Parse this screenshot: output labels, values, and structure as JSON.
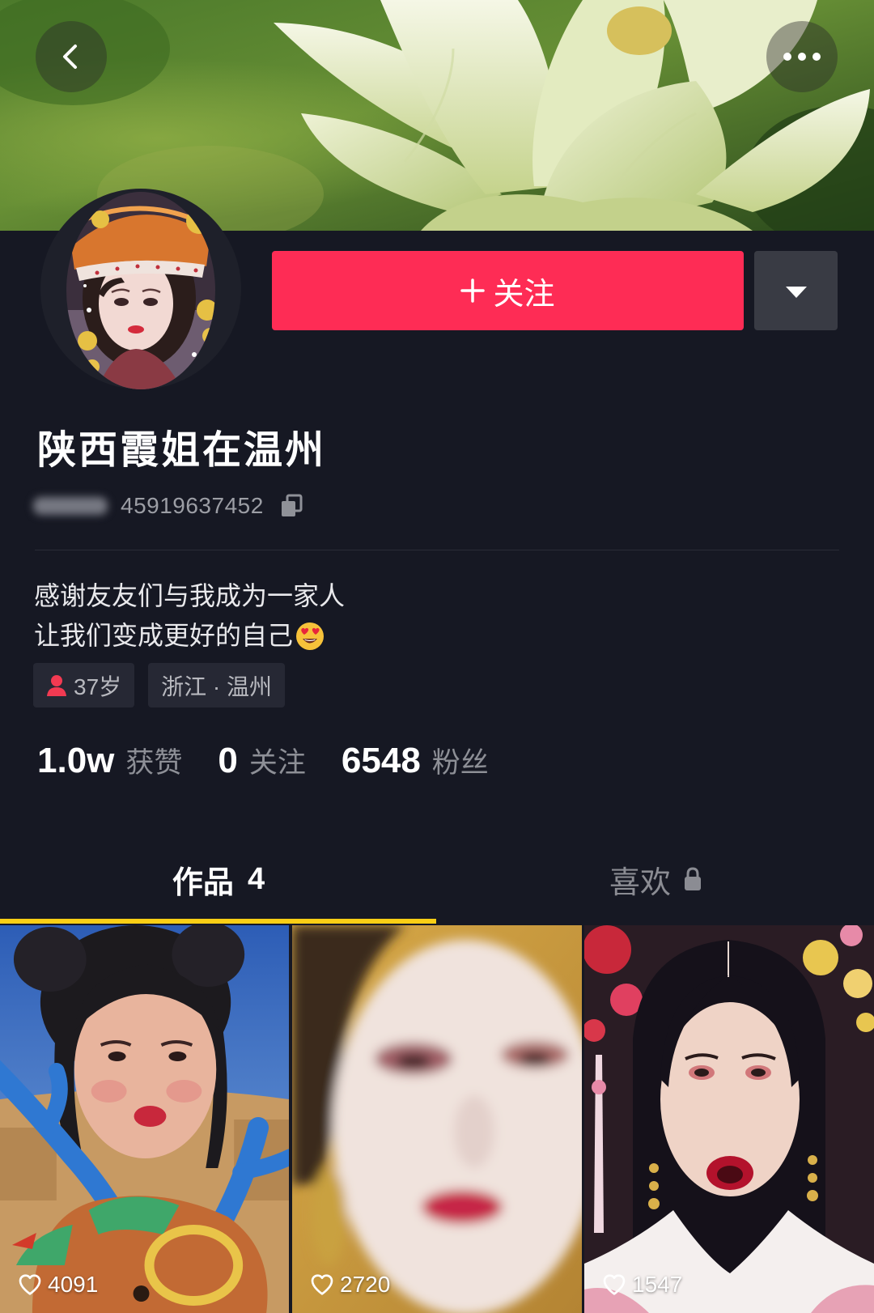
{
  "banner": {
    "back_icon": "chevron-left-icon",
    "more_icon": "more-dots-icon"
  },
  "actions": {
    "follow_icon": "plus-icon",
    "follow_label": "关注",
    "dropdown_icon": "triangle-down-icon"
  },
  "profile": {
    "name": "陕西霞姐在温州",
    "id_number": "45919637452",
    "copy_icon": "copy-icon",
    "bio": [
      "感谢友友们与我成为一家人",
      "让我们变成更好的自己"
    ],
    "bio_emoji": "heart-eyes-emoji-icon",
    "tags": [
      {
        "icon": "person-icon",
        "label": "37岁"
      },
      {
        "label": "浙江 · 温州"
      }
    ]
  },
  "stats": [
    {
      "value": "1.0w",
      "label": "获赞"
    },
    {
      "value": "0",
      "label": "关注"
    },
    {
      "value": "6548",
      "label": "粉丝"
    }
  ],
  "tabs": [
    {
      "label": "作品",
      "count": "4",
      "active": true
    },
    {
      "label": "喜欢",
      "icon": "lock-icon",
      "active": false
    }
  ],
  "videos": [
    {
      "likes": "4091",
      "icon": "heart-outline-icon"
    },
    {
      "likes": "2720",
      "icon": "heart-outline-icon"
    },
    {
      "likes": "1547",
      "icon": "heart-outline-icon"
    }
  ],
  "colors": {
    "background": "#161823",
    "follow_button": "#fe2c55",
    "tab_indicator": "#face15",
    "tag_background": "#262834"
  }
}
